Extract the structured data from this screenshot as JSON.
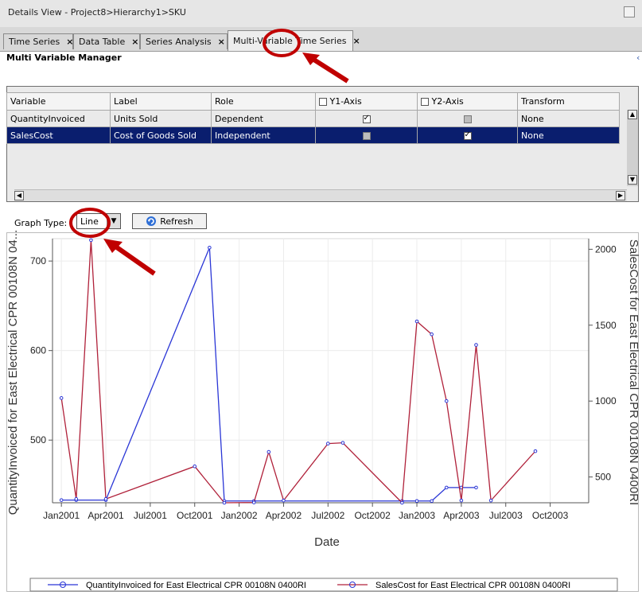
{
  "window": {
    "title": "Details View - Project8>Hierarchy1>SKU"
  },
  "tabs": [
    {
      "label": "Time Series",
      "close": "×"
    },
    {
      "label": "Data Table",
      "close": "×"
    },
    {
      "label": "Series Analysis",
      "close": "×"
    },
    {
      "label": "Multi-Variable Time Series",
      "close": "×",
      "active": true
    }
  ],
  "manager": {
    "title": "Multi Variable Manager"
  },
  "grid": {
    "headers": [
      "Variable",
      "Label",
      "Role",
      "Y1-Axis",
      "Y2-Axis",
      "Transform"
    ],
    "rows": [
      {
        "variable": "QuantityInvoiced",
        "label": "Units Sold",
        "role": "Dependent",
        "y1": true,
        "y2": false,
        "transform": "None",
        "selected": false
      },
      {
        "variable": "SalesCost",
        "label": "Cost of Goods Sold",
        "role": "Independent",
        "y1": false,
        "y2": true,
        "transform": "None",
        "selected": true
      }
    ]
  },
  "controls": {
    "graph_type_label": "Graph Type:",
    "graph_type_value": "Line",
    "refresh_label": "Refresh"
  },
  "colors": {
    "series_blue": "#2a36d6",
    "series_red": "#b0213a",
    "annotation_red": "#c00000",
    "selection": "#0a1e6e"
  },
  "chart_data": {
    "type": "line",
    "xlabel": "Date",
    "ylabel": "QuantityInvoiced for East Electrical CPR 00108N 04...",
    "y2label": "SalesCost for East Electrical CPR 00108N 0400RI",
    "x_ticks": [
      "Jan2001",
      "Apr2001",
      "Jul2001",
      "Oct2001",
      "Jan2002",
      "Apr2002",
      "Jul2002",
      "Oct2002",
      "Jan2003",
      "Apr2003",
      "Jul2003",
      "Oct2003"
    ],
    "y_ticks": [
      500,
      600,
      700
    ],
    "y2_ticks": [
      500,
      1000,
      1500,
      2000
    ],
    "ylim": [
      430,
      725
    ],
    "y2lim": [
      330,
      2070
    ],
    "grid": true,
    "legend_position": "bottom",
    "series": [
      {
        "name": "QuantityInvoiced for East Electrical CPR 00108N 0400RI",
        "axis": "y1",
        "points": [
          [
            "2001-01-01",
            433
          ],
          [
            "2001-02-01",
            433
          ],
          [
            "2001-04-01",
            433
          ],
          [
            "2001-11-01",
            715
          ],
          [
            "2001-12-01",
            432
          ],
          [
            "2002-02-01",
            432
          ],
          [
            "2002-12-01",
            432
          ],
          [
            "2003-01-01",
            432
          ],
          [
            "2003-02-01",
            432
          ],
          [
            "2003-03-01",
            447
          ],
          [
            "2003-04-01",
            447
          ],
          [
            "2003-05-01",
            447
          ]
        ]
      },
      {
        "name": "SalesCost for East Electrical CPR 00108N 0400RI",
        "axis": "y2",
        "points": [
          [
            "2001-01-01",
            1020
          ],
          [
            "2001-02-01",
            355
          ],
          [
            "2001-03-01",
            2060
          ],
          [
            "2001-04-01",
            355
          ],
          [
            "2001-10-01",
            570
          ],
          [
            "2001-12-01",
            330
          ],
          [
            "2002-02-01",
            332
          ],
          [
            "2002-03-01",
            665
          ],
          [
            "2002-04-01",
            345
          ],
          [
            "2002-07-01",
            720
          ],
          [
            "2002-08-01",
            725
          ],
          [
            "2002-12-01",
            330
          ],
          [
            "2003-01-01",
            1525
          ],
          [
            "2003-02-01",
            1440
          ],
          [
            "2003-03-01",
            1000
          ],
          [
            "2003-04-01",
            345
          ],
          [
            "2003-05-01",
            1370
          ],
          [
            "2003-06-01",
            345
          ],
          [
            "2003-09-01",
            670
          ]
        ]
      }
    ]
  }
}
